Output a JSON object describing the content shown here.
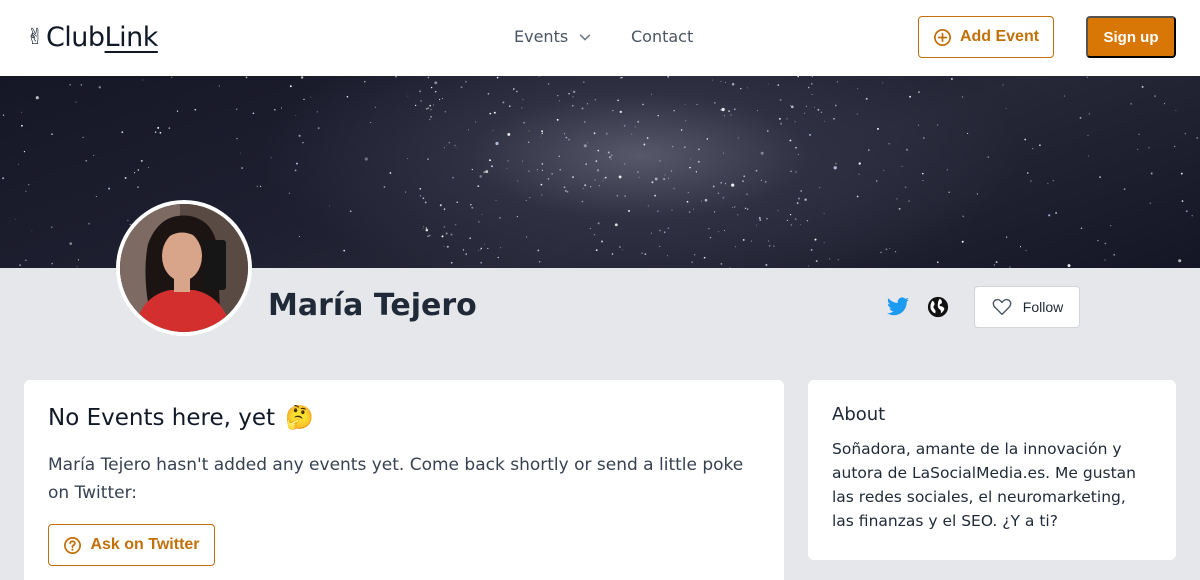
{
  "header": {
    "logo_emoji": "✌",
    "logo_part1": "Club",
    "logo_part2": "Link",
    "nav": {
      "events_label": "Events",
      "contact_label": "Contact"
    },
    "add_event_label": "Add Event",
    "signup_label": "Sign up"
  },
  "profile": {
    "name": "María Tejero",
    "follow_label": "Follow"
  },
  "events_card": {
    "title": "No Events here, yet",
    "title_emoji": "🤔",
    "message": "María Tejero hasn't added any events yet. Come back shortly or send a little poke on Twitter:",
    "ask_label": "Ask on Twitter"
  },
  "about_card": {
    "title": "About",
    "text": "Soñadora, amante de la innovación y autora de LaSocialMedia.es. Me gustan las redes sociales, el neuromarketing, las finanzas y el SEO. ¿Y a ti?"
  },
  "colors": {
    "accent": "#d97706",
    "accent_border": "#c2700a",
    "twitter": "#1d9bf0",
    "page_bg": "#e5e7eb"
  },
  "icons": {
    "events_chevron": "chevron-down-icon",
    "add_event": "plus-circle-icon",
    "twitter": "twitter-icon",
    "website": "globe-icon",
    "follow": "heart-icon",
    "ask": "question-circle-icon"
  }
}
